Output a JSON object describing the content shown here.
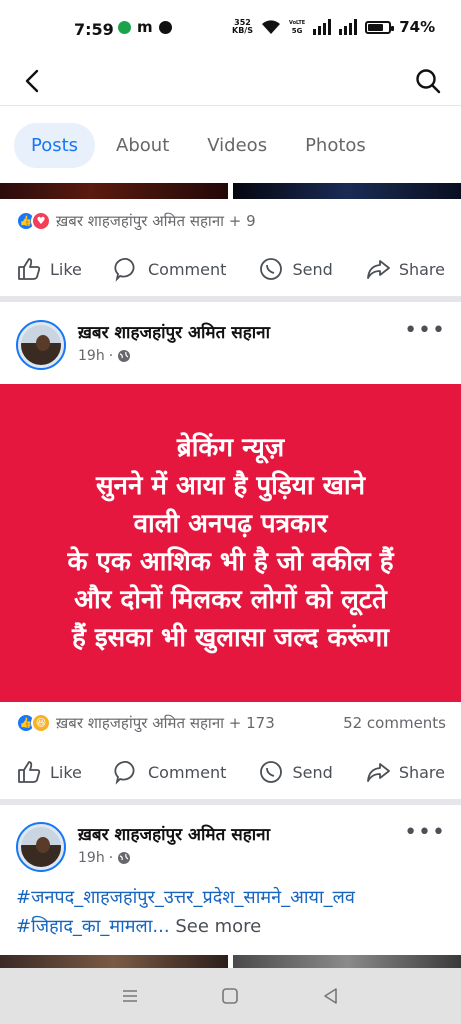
{
  "status_bar": {
    "time": "7:59",
    "speed_value": "352",
    "speed_unit": "KB/S",
    "volte_top": "VoLTE",
    "volte_bottom": "5G",
    "battery_percent": "74%",
    "battery_level": 0.74
  },
  "header": {
    "back_icon": "back-arrow-icon",
    "search_icon": "search-icon"
  },
  "tabs": [
    "Posts",
    "About",
    "Videos",
    "Photos"
  ],
  "active_tab": "Posts",
  "post1": {
    "reactions_text": "ख़बर शाहजहांपुर अमित सहाना + 9",
    "actions": [
      "Like",
      "Comment",
      "Send",
      "Share"
    ]
  },
  "post2": {
    "author": "ख़बर शाहजहांपुर अमित सहाना",
    "time": "19h",
    "text": "ब्रेकिंग न्यूज़\nसुनने में आया है पुड़िया खाने\nवाली अनपढ़ पत्रकार\nके एक आशिक भी है जो वकील हैं\nऔर दोनों मिलकर लोगों को लूटते\nहैं इसका भी खुलासा जल्द करूंगा",
    "background_color": "#e5173f",
    "reactions_text": "ख़बर शाहजहांपुर अमित सहाना + 173",
    "comments": "52 comments",
    "actions": [
      "Like",
      "Comment",
      "Send",
      "Share"
    ]
  },
  "post3": {
    "author": "ख़बर शाहजहांपुर अमित सहाना",
    "time": "19h",
    "hashtags": "#जनपद_शाहजहांपुर_उत्तर_प्रदेश_सामने_आया_लव #जिहाद_का_मामला...",
    "see_more": " See more"
  },
  "colors": {
    "accent": "#1877f2",
    "post_bg": "#e5173f"
  }
}
